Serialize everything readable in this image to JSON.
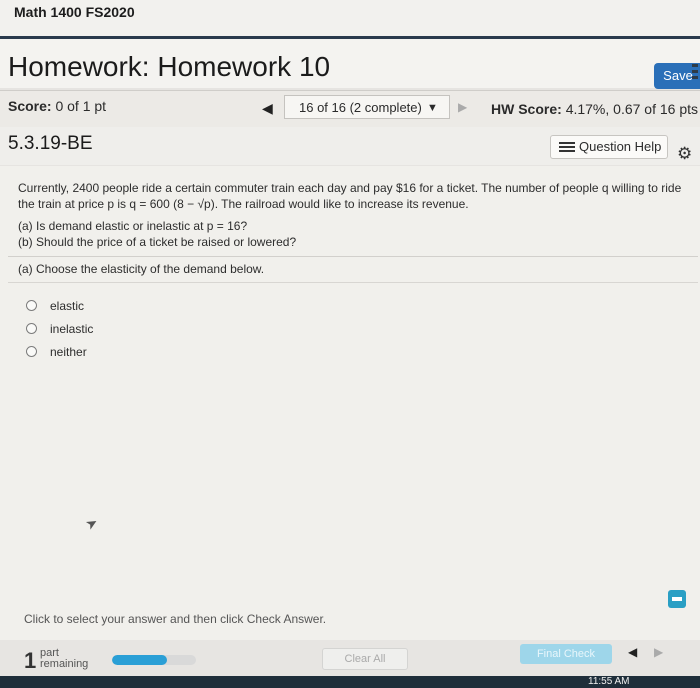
{
  "course": {
    "title": "Math 1400 FS2020"
  },
  "header": {
    "title": "Homework: Homework 10",
    "save_label": "Save"
  },
  "score_bar": {
    "score_label": "Score:",
    "score_value": "0 of 1 pt",
    "question_nav": "16 of 16 (2 complete)",
    "hw_score_label": "HW Score:",
    "hw_score_value": "4.17%, 0.67 of 16 pts"
  },
  "question": {
    "id": "5.3.19-BE",
    "help_label": "Question Help",
    "text_line1": "Currently, 2400 people ride a certain commuter train each day and pay $16 for a ticket. The number of people q willing to ride",
    "text_line2_pre": "the train at price p is q = 600 (8 − ",
    "text_sqrt": "√p",
    "text_line2_post": "). The railroad would like to increase its revenue.",
    "part_a": "(a) Is demand elastic or inelastic at p = 16?",
    "part_b": "(b) Should the price of a ticket be raised or lowered?",
    "prompt": "(a) Choose the elasticity of the demand below.",
    "options": [
      {
        "label": "elastic"
      },
      {
        "label": "inelastic"
      },
      {
        "label": "neither"
      }
    ],
    "instruction": "Click to select your answer and then click Check Answer."
  },
  "footer": {
    "parts_count": "1",
    "parts_text_1": "part",
    "parts_text_2": "remaining",
    "progress_fraction": 0.65,
    "clear_label": "Clear All",
    "final_label": "Final Check"
  },
  "taskbar": {
    "clock": "11:55 AM"
  },
  "colors": {
    "save": "#2a6fb8",
    "progress": "#2a9fd6",
    "header_rule": "#2a3a4c"
  }
}
